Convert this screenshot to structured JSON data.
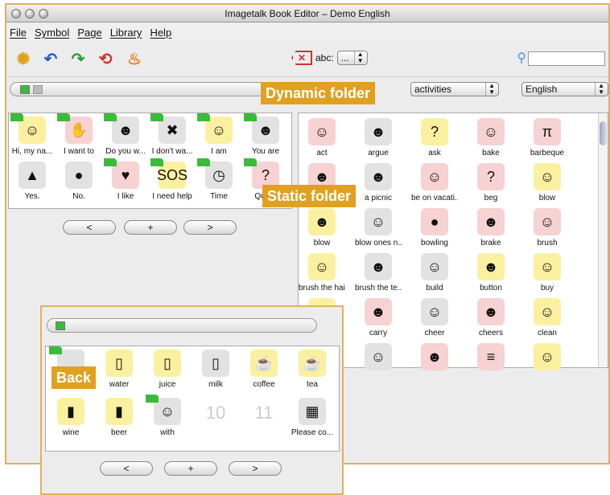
{
  "window": {
    "title": "Imagetalk Book Editor – Demo English"
  },
  "menu": [
    "File",
    "Symbol",
    "Page",
    "Library",
    "Help"
  ],
  "toolbar": {
    "abc_label": "abc:",
    "abc_value": "...",
    "icons": [
      "lightbulb-icon",
      "undo-icon",
      "redo-icon",
      "reload-icon",
      "steam-icon"
    ]
  },
  "selectors": {
    "category": "activities",
    "language": "English"
  },
  "callouts": {
    "dynamic": "Dynamic folder",
    "static": "Static folder",
    "back": "Back"
  },
  "left_symbols": [
    {
      "label": "Hi, my na...",
      "icon": "☺",
      "color": "#fbf0a0",
      "folder": true
    },
    {
      "label": "I want to",
      "icon": "✋",
      "color": "#f6d2d2",
      "folder": true
    },
    {
      "label": "Do you w...",
      "icon": "☻",
      "color": "#e2e2e2",
      "folder": true
    },
    {
      "label": "I don't wa...",
      "icon": "✖",
      "color": "#e2e2e2",
      "folder": true
    },
    {
      "label": "I am",
      "icon": "☺",
      "color": "#fbf0a0",
      "folder": true
    },
    {
      "label": "You are",
      "icon": "☻",
      "color": "#e2e2e2",
      "folder": true
    },
    {
      "label": "Yes.",
      "icon": "▲",
      "color": "#e2e2e2",
      "folder": false
    },
    {
      "label": "No.",
      "icon": "●",
      "color": "#e2e2e2",
      "folder": false
    },
    {
      "label": "I like",
      "icon": "♥",
      "color": "#f6d2d2",
      "folder": true
    },
    {
      "label": "I need help",
      "icon": "SOS",
      "color": "#fbf0a0",
      "folder": true
    },
    {
      "label": "Time",
      "icon": "◷",
      "color": "#e2e2e2",
      "folder": true
    },
    {
      "label": "Que...",
      "icon": "?",
      "color": "#f6d2d2",
      "folder": true
    }
  ],
  "nav": {
    "prev": "<",
    "add": "+",
    "next": ">"
  },
  "right_symbols": [
    {
      "label": "act",
      "icon": "☺",
      "color": "#f6d2d2"
    },
    {
      "label": "argue",
      "icon": "☻",
      "color": "#e2e2e2"
    },
    {
      "label": "ask",
      "icon": "?",
      "color": "#fbf0a0"
    },
    {
      "label": "bake",
      "icon": "☺",
      "color": "#f6d2d2"
    },
    {
      "label": "barbeque",
      "icon": "π",
      "color": "#f6d2d2"
    },
    {
      "label": "",
      "icon": "☻",
      "color": "#f6d2d2"
    },
    {
      "label": "a picnic",
      "icon": "☻",
      "color": "#e2e2e2"
    },
    {
      "label": "be on vacati...",
      "icon": "☺",
      "color": "#f6d2d2"
    },
    {
      "label": "beg",
      "icon": "?",
      "color": "#f6d2d2"
    },
    {
      "label": "blow",
      "icon": "☺",
      "color": "#fbf0a0"
    },
    {
      "label": "blow",
      "icon": "☻",
      "color": "#fbf0a0"
    },
    {
      "label": "blow ones n...",
      "icon": "☺",
      "color": "#e2e2e2"
    },
    {
      "label": "bowling",
      "icon": "●",
      "color": "#f6d2d2"
    },
    {
      "label": "brake",
      "icon": "☻",
      "color": "#f6d2d2"
    },
    {
      "label": "brush",
      "icon": "☺",
      "color": "#f6d2d2"
    },
    {
      "label": "brush the hair",
      "icon": "☺",
      "color": "#fbf0a0"
    },
    {
      "label": "brush the te...",
      "icon": "☻",
      "color": "#e2e2e2"
    },
    {
      "label": "build",
      "icon": "☺",
      "color": "#e2e2e2"
    },
    {
      "label": "button",
      "icon": "☻",
      "color": "#fbf0a0"
    },
    {
      "label": "buy",
      "icon": "☺",
      "color": "#fbf0a0"
    },
    {
      "label": "",
      "icon": "☺",
      "color": "#fbf0a0"
    },
    {
      "label": "carry",
      "icon": "☻",
      "color": "#f6d2d2"
    },
    {
      "label": "cheer",
      "icon": "☺",
      "color": "#e2e2e2"
    },
    {
      "label": "cheers",
      "icon": "☻",
      "color": "#f6d2d2"
    },
    {
      "label": "clean",
      "icon": "☺",
      "color": "#fbf0a0"
    },
    {
      "label": "",
      "icon": "☻",
      "color": "#f6d2d2"
    },
    {
      "label": "",
      "icon": "☺",
      "color": "#e2e2e2"
    },
    {
      "label": "",
      "icon": "☻",
      "color": "#f6d2d2"
    },
    {
      "label": "",
      "icon": "≡",
      "color": "#f6d2d2"
    },
    {
      "label": "",
      "icon": "☺",
      "color": "#fbf0a0"
    }
  ],
  "popup_symbols": [
    {
      "label": "",
      "icon": "",
      "color": "#e2e2e2",
      "folder": true
    },
    {
      "label": "water",
      "icon": "▯",
      "color": "#fbf0a0"
    },
    {
      "label": "juice",
      "icon": "▯",
      "color": "#fbf0a0"
    },
    {
      "label": "milk",
      "icon": "▯",
      "color": "#e2e2e2"
    },
    {
      "label": "coffee",
      "icon": "☕",
      "color": "#fbf0a0"
    },
    {
      "label": "tea",
      "icon": "☕",
      "color": "#fbf0a0"
    },
    {
      "label": "wine",
      "icon": "▮",
      "color": "#fbf0a0"
    },
    {
      "label": "beer",
      "icon": "▮",
      "color": "#fbf0a0"
    },
    {
      "label": "with",
      "icon": "☺",
      "color": "#e2e2e2",
      "folder": true
    },
    {
      "label": "",
      "num": "10"
    },
    {
      "label": "",
      "num": "11"
    },
    {
      "label": "Please co...",
      "icon": "▦",
      "color": "#e2e2e2"
    }
  ]
}
